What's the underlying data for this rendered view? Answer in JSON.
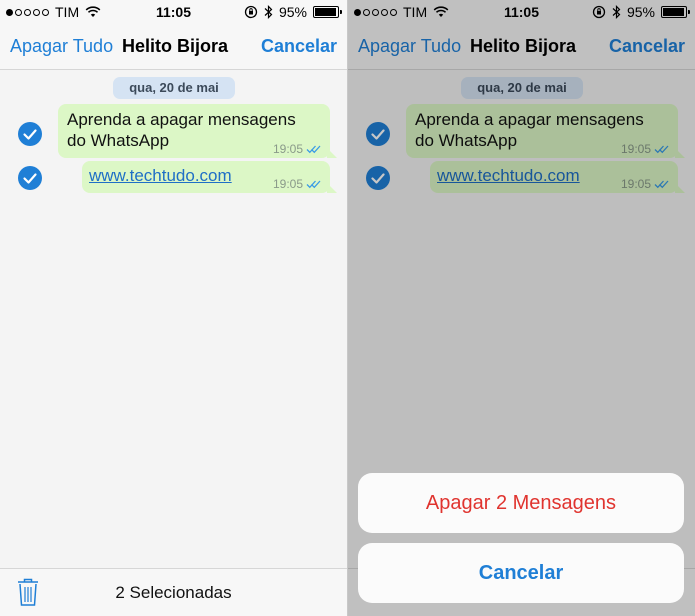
{
  "status": {
    "carrier": "TIM",
    "time": "11:05",
    "battery": "95%",
    "battery_level": 0.95
  },
  "nav": {
    "left": "Apagar Tudo",
    "title": "Helito Bijora",
    "right": "Cancelar"
  },
  "chat": {
    "date": "qua, 20 de mai",
    "messages": [
      {
        "text": "Aprenda a apagar mensagens do WhatsApp",
        "time": "19:05"
      },
      {
        "text": "www.techtudo.com",
        "time": "19:05"
      }
    ]
  },
  "bottom": {
    "selected": "2 Selecionadas"
  },
  "sheet": {
    "destructive": "Apagar 2 Mensagens",
    "cancel": "Cancelar"
  },
  "colors": {
    "accent": "#1f7fd6",
    "bubble": "#dcf7c6",
    "destructive": "#e0342f"
  },
  "icons": [
    "wifi-icon",
    "orientation-lock-icon",
    "bluetooth-icon",
    "battery-icon",
    "check-icon",
    "double-check-icon",
    "trash-icon"
  ]
}
